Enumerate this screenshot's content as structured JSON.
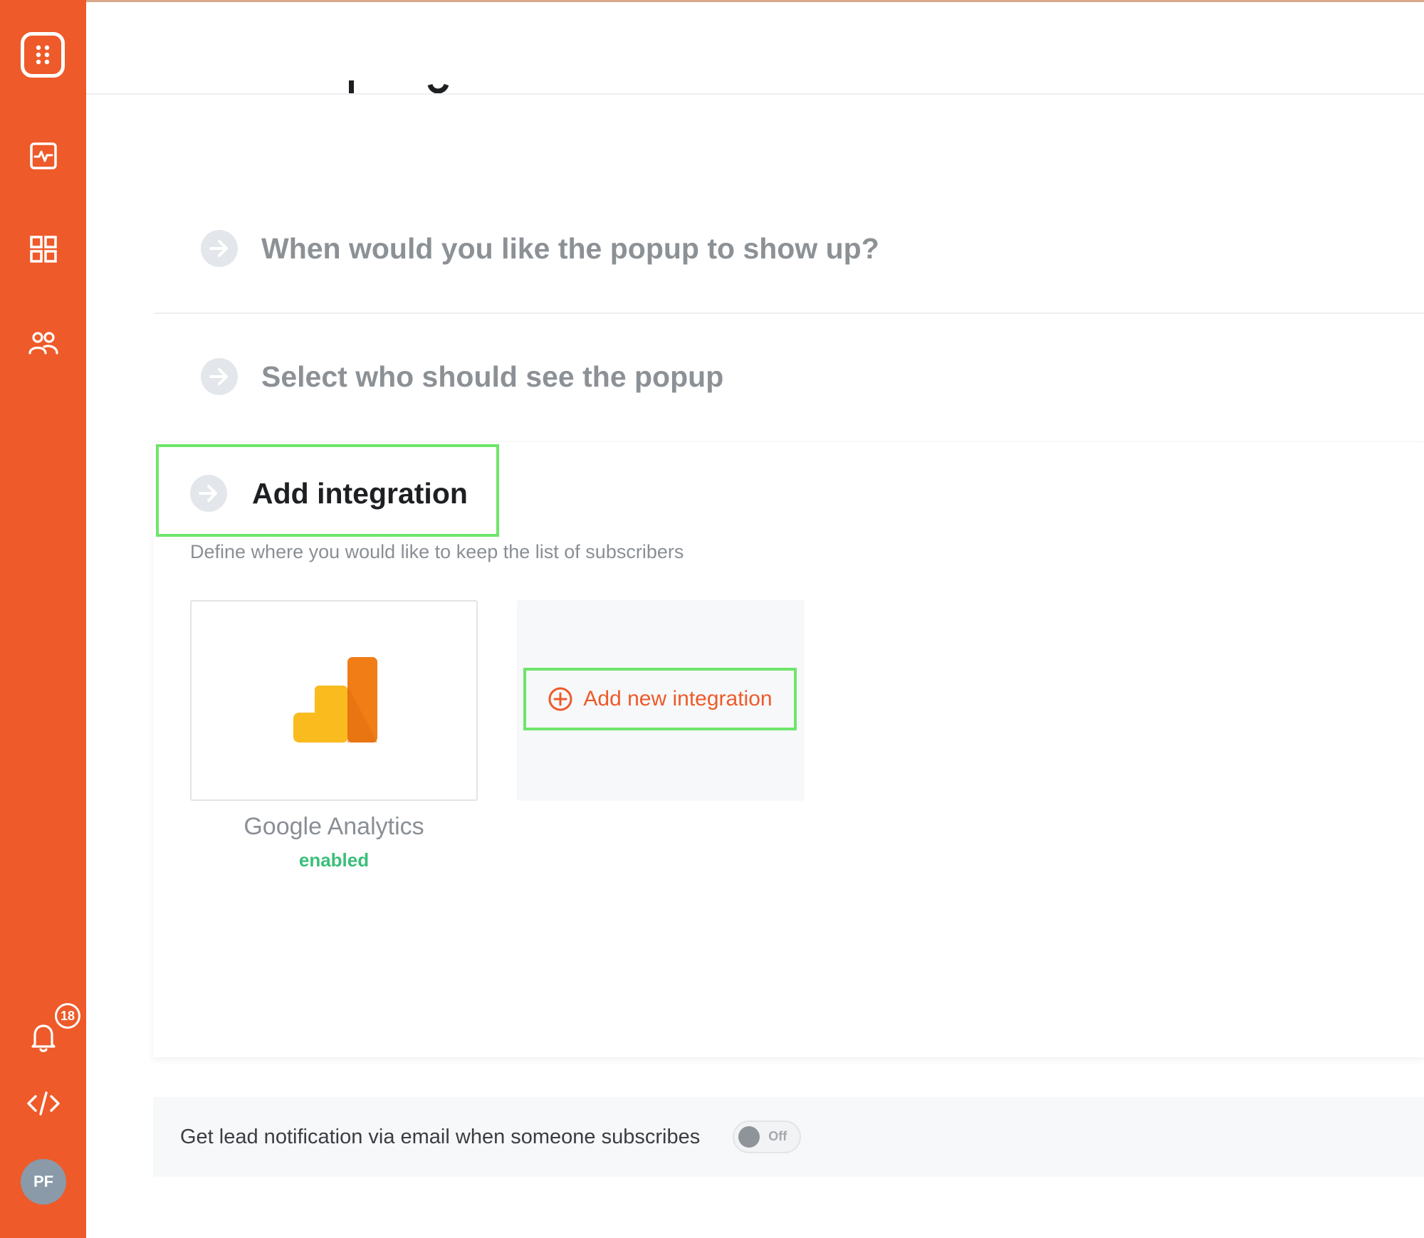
{
  "sidebar": {
    "icons": [
      "logo-icon",
      "activity-icon",
      "grid-icon",
      "users-icon",
      "bell-icon",
      "code-icon"
    ],
    "notification_count": "18",
    "avatar_initials": "PF"
  },
  "steps": {
    "when_title": "When would you like the popup to show up?",
    "who_title": "Select who should see the popup",
    "integration_title": "Add integration",
    "integration_subtitle": "Define where you would like to keep the list of subscribers"
  },
  "integrations": {
    "items": [
      {
        "name": "Google Analytics",
        "status": "enabled"
      }
    ],
    "add_label": "Add new integration"
  },
  "notification": {
    "text": "Get lead notification via email when someone subscribes",
    "toggle_label": "Off",
    "toggle_state": "off"
  },
  "colors": {
    "brand": "#ee5a29",
    "highlight": "#6ee56a",
    "enabled": "#3bbf7a"
  }
}
